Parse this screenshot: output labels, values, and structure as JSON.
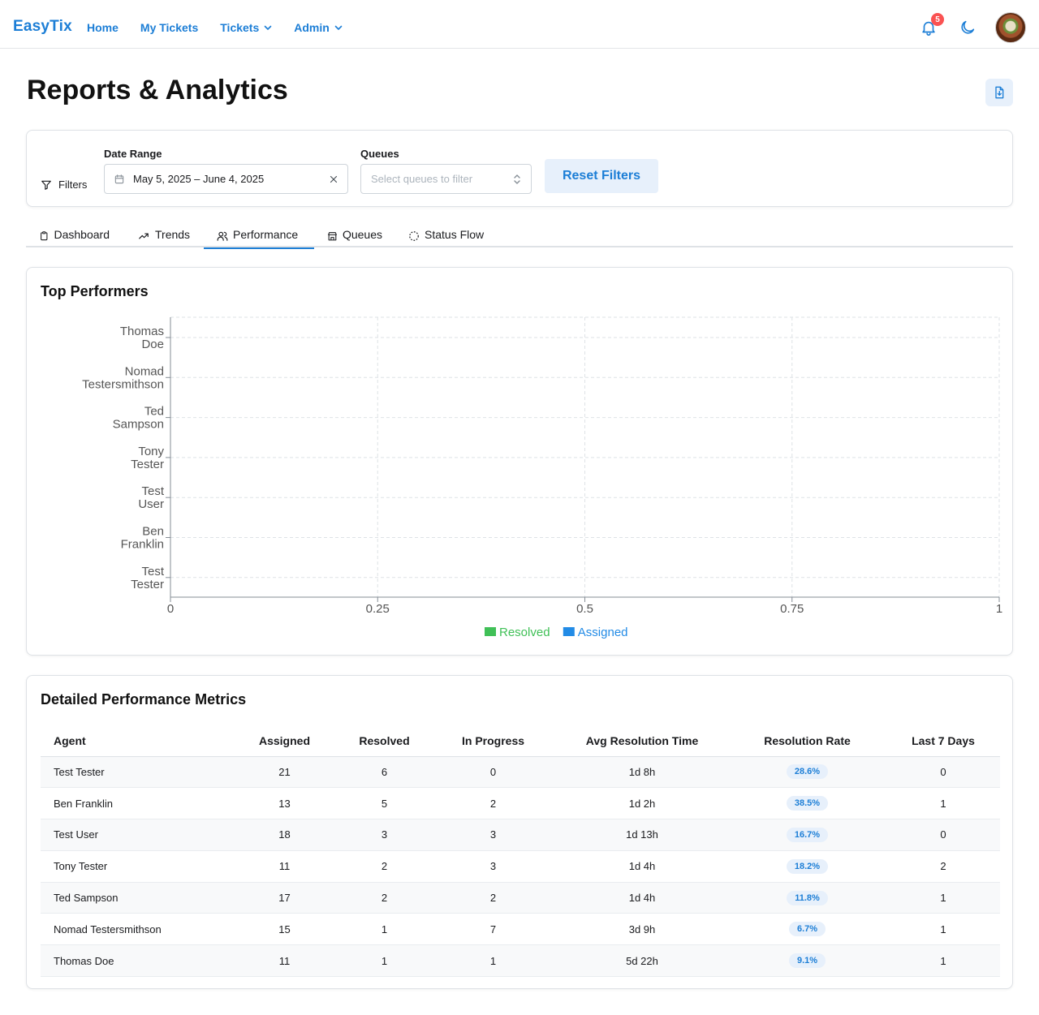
{
  "header": {
    "brand": "EasyTix",
    "nav": [
      {
        "label": "Home"
      },
      {
        "label": "My Tickets"
      },
      {
        "label": "Tickets"
      },
      {
        "label": "Admin"
      }
    ],
    "notification_count": "5"
  },
  "page": {
    "title": "Reports & Analytics"
  },
  "filters": {
    "label": "Filters",
    "date_range_label": "Date Range",
    "date_range_value": "May 5, 2025 – June 4, 2025",
    "queues_label": "Queues",
    "queues_placeholder": "Select queues to filter",
    "reset_label": "Reset Filters"
  },
  "tabs": [
    {
      "label": "Dashboard"
    },
    {
      "label": "Trends"
    },
    {
      "label": "Performance"
    },
    {
      "label": "Queues"
    },
    {
      "label": "Status Flow"
    }
  ],
  "active_tab": "Performance",
  "chart_data": {
    "type": "bar",
    "title": "Top Performers",
    "orientation": "horizontal",
    "categories": [
      "Thomas Doe",
      "Nomad Testersmithson",
      "Ted Sampson",
      "Tony Tester",
      "Test User",
      "Ben Franklin",
      "Test Tester"
    ],
    "category_lines": [
      [
        "Thomas",
        "Doe"
      ],
      [
        "Nomad",
        "Testersmithson"
      ],
      [
        "Ted",
        "Sampson"
      ],
      [
        "Tony",
        "Tester"
      ],
      [
        "Test",
        "User"
      ],
      [
        "Ben",
        "Franklin"
      ],
      [
        "Test",
        "Tester"
      ]
    ],
    "series": [
      {
        "name": "Resolved",
        "color": "#40c057",
        "values": [
          0,
          0,
          0,
          0,
          0,
          0,
          0
        ]
      },
      {
        "name": "Assigned",
        "color": "#228be6",
        "values": [
          0,
          0,
          0,
          0,
          0,
          0,
          0
        ]
      }
    ],
    "xlim": [
      0,
      1
    ],
    "xticks": [
      "0",
      "0.25",
      "0.5",
      "0.75",
      "1"
    ],
    "grid": true,
    "legend": "bottom-center"
  },
  "table": {
    "title": "Detailed Performance Metrics",
    "columns": [
      "Agent",
      "Assigned",
      "Resolved",
      "In Progress",
      "Avg Resolution Time",
      "Resolution Rate",
      "Last 7 Days"
    ],
    "rows": [
      [
        "Test Tester",
        "21",
        "6",
        "0",
        "1d 8h",
        "28.6%",
        "0"
      ],
      [
        "Ben Franklin",
        "13",
        "5",
        "2",
        "1d 2h",
        "38.5%",
        "1"
      ],
      [
        "Test User",
        "18",
        "3",
        "3",
        "1d 13h",
        "16.7%",
        "0"
      ],
      [
        "Tony Tester",
        "11",
        "2",
        "3",
        "1d 4h",
        "18.2%",
        "2"
      ],
      [
        "Ted Sampson",
        "17",
        "2",
        "2",
        "1d 4h",
        "11.8%",
        "1"
      ],
      [
        "Nomad Testersmithson",
        "15",
        "1",
        "7",
        "3d 9h",
        "6.7%",
        "1"
      ],
      [
        "Thomas Doe",
        "11",
        "1",
        "1",
        "5d 22h",
        "9.1%",
        "1"
      ]
    ]
  }
}
